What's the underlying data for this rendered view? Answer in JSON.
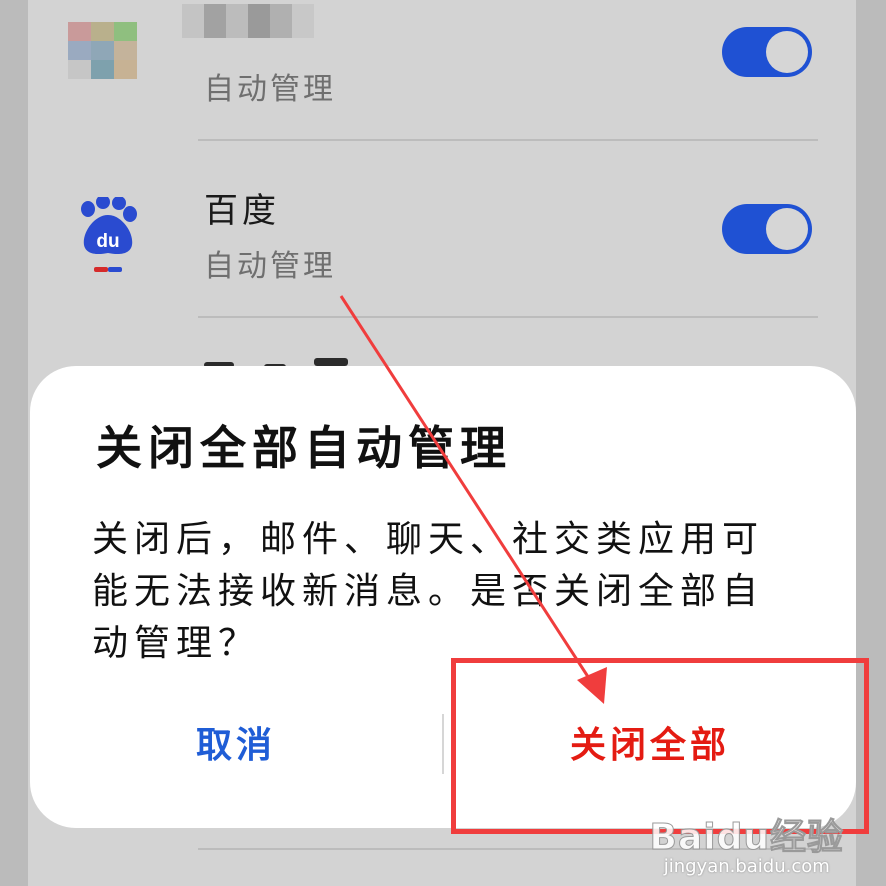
{
  "apps": [
    {
      "name": "",
      "subtitle": "自动管理",
      "toggle_on": true,
      "icon": "blurred-app-icon"
    },
    {
      "name": "百度",
      "subtitle": "自动管理",
      "toggle_on": true,
      "icon": "baidu-paw-icon",
      "icon_text": "du"
    }
  ],
  "dialog": {
    "title": "关闭全部自动管理",
    "message": "关闭后，邮件、聊天、社交类应用可能无法接收新消息。是否关闭全部自动管理？",
    "cancel_label": "取消",
    "confirm_label": "关闭全部"
  },
  "watermark": {
    "logo": "Baidu经验",
    "url": "jingyan.baidu.com"
  },
  "colors": {
    "toggle": "#1f51d3",
    "cancel": "#1f5dd6",
    "confirm": "#e41b12",
    "annotation": "#f03d3d"
  }
}
